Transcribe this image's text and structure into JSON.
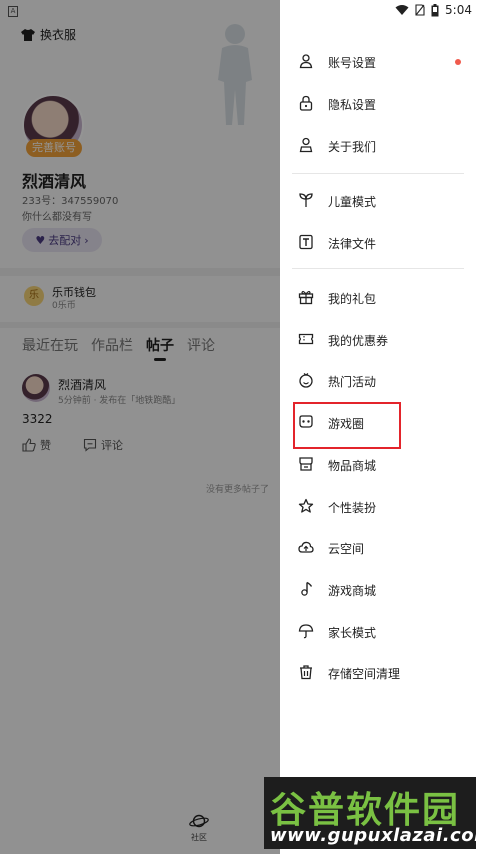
{
  "status_bar": {
    "time": "5:04"
  },
  "profile": {
    "costume_label": "换衣服",
    "complete_badge": "完善账号",
    "nickname": "烈酒清风",
    "uid": "233号：347559070",
    "bio": "你什么都没有写",
    "match_label": "去配对",
    "wallet_title": "乐币钱包",
    "wallet_balance": "0乐币",
    "tabs": [
      "最近在玩",
      "作品栏",
      "帖子",
      "评论"
    ],
    "active_tab": "帖子",
    "post": {
      "author": "烈酒清风",
      "meta": "5分钟前 · 发布在「地铁跑酷」",
      "body": "3322",
      "like_label": "赞",
      "comment_label": "评论"
    },
    "no_more": "没有更多帖子了",
    "community_label": "社区"
  },
  "drawer": {
    "items": [
      {
        "label": "账号设置",
        "icon": "person-icon"
      },
      {
        "label": "隐私设置",
        "icon": "lock-icon"
      },
      {
        "label": "关于我们",
        "icon": "info-person-icon"
      },
      {
        "label": "儿童模式",
        "icon": "sprout-icon"
      },
      {
        "label": "法律文件",
        "icon": "document-t-icon"
      },
      {
        "label": "我的礼包",
        "icon": "gift-icon"
      },
      {
        "label": "我的优惠券",
        "icon": "coupon-icon"
      },
      {
        "label": "热门活动",
        "icon": "smile-badge-icon"
      },
      {
        "label": "游戏圈",
        "icon": "game-circle-icon"
      },
      {
        "label": "物品商城",
        "icon": "store-icon"
      },
      {
        "label": "个性装扮",
        "icon": "star-outline-icon"
      },
      {
        "label": "云空间",
        "icon": "cloud-icon"
      },
      {
        "label": "游戏商城",
        "icon": "music-note-icon"
      },
      {
        "label": "家长模式",
        "icon": "umbrella-icon"
      },
      {
        "label": "存储空间清理",
        "icon": "trash-icon"
      }
    ],
    "accent_red": "#e3242b"
  },
  "watermark": {
    "title": "谷普软件园",
    "url": "www.gupuxlazai.com"
  }
}
